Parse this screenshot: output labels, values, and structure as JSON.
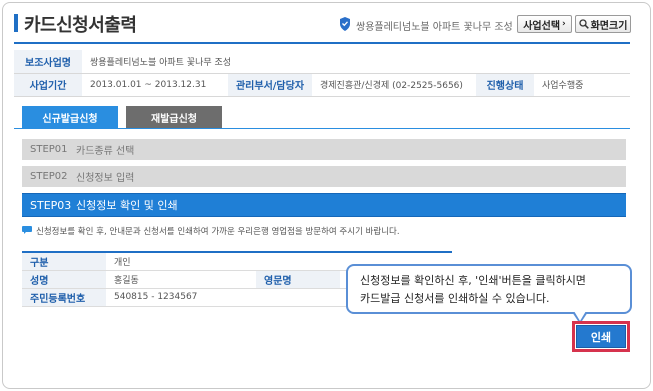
{
  "header": {
    "title": "카드신청서출력",
    "business_name": "쌍용플레티넘노블 아파트 꽃나무 조성",
    "select_business_label": "사업선택",
    "screen_size_label": "화면크기"
  },
  "info": {
    "program_label": "보조사업명",
    "program_value": "쌍용플레티넘노블 아파트 꽃나무 조성",
    "period_label": "사업기간",
    "period_value": "2013.01.01 ~ 2013.12.31",
    "dept_label": "관리부서/담당자",
    "dept_value": "경제진흥관/신경제 (02-2525-5656)",
    "status_label": "진행상태",
    "status_value": "사업수행중"
  },
  "tabs": {
    "new_label": "신규발급신청",
    "reissue_label": "재발급신청"
  },
  "steps": [
    {
      "num": "STEP01",
      "label": "카드종류 선택"
    },
    {
      "num": "STEP02",
      "label": "신청정보 입력"
    },
    {
      "num": "STEP03",
      "label": "신청정보 확인 및 인쇄"
    }
  ],
  "notice": "신청정보를 확인 후, 안내문과 신청서를 인쇄하여 가까운 우리은행 영업점을 방문하여 주시기 바랍니다.",
  "applicant": {
    "type_label": "구분",
    "type_value": "개인",
    "name_label": "성명",
    "name_value": "홍길동",
    "eng_name_label": "영문명",
    "eng_name_value": "",
    "rrn_label": "주민등록번호",
    "rrn_value": "540815 - 1234567"
  },
  "tooltip": {
    "line1": "신청정보를 확인하신 후, '인쇄'버튼을 클릭하시면",
    "line2": "카드발급 신청서를 인쇄하실 수 있습니다."
  },
  "print_label": "인쇄",
  "colors": {
    "accent": "#1f6fc5",
    "tab_active": "#2a8ee0",
    "tab_inactive": "#6d6d6d",
    "highlight": "#d6334d"
  }
}
